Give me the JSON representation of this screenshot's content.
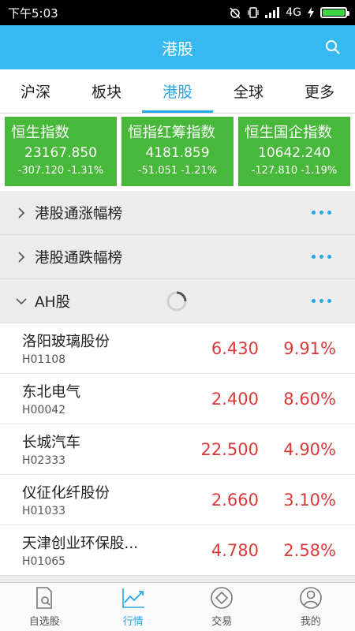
{
  "status": {
    "time": "下午5:03",
    "network": "4G"
  },
  "header": {
    "title": "港股"
  },
  "tabs": [
    {
      "label": "沪深"
    },
    {
      "label": "板块"
    },
    {
      "label": "港股",
      "active": true
    },
    {
      "label": "全球"
    },
    {
      "label": "更多"
    }
  ],
  "indices": [
    {
      "name": "恒生指数",
      "value": "23167.850",
      "change": "-307.120  -1.31%"
    },
    {
      "name": "恒指红筹指数",
      "value": "4181.859",
      "change": "-51.051  -1.21%"
    },
    {
      "name": "恒生国企指数",
      "value": "10642.240",
      "change": "-127.810  -1.19%"
    }
  ],
  "sections": [
    {
      "label": "港股通涨幅榜",
      "expanded": false
    },
    {
      "label": "港股通跌幅榜",
      "expanded": false
    },
    {
      "label": "AH股",
      "expanded": true
    }
  ],
  "stocks": [
    {
      "name": "洛阳玻璃股份",
      "code": "H01108",
      "price": "6.430",
      "pct": "9.91%"
    },
    {
      "name": "东北电气",
      "code": "H00042",
      "price": "2.400",
      "pct": "8.60%"
    },
    {
      "name": "长城汽车",
      "code": "H02333",
      "price": "22.500",
      "pct": "4.90%"
    },
    {
      "name": "仪征化纤股份",
      "code": "H01033",
      "price": "2.660",
      "pct": "3.10%"
    },
    {
      "name": "天津创业环保股...",
      "code": "H01065",
      "price": "4.780",
      "pct": "2.58%"
    }
  ],
  "nav": [
    {
      "label": "自选股"
    },
    {
      "label": "行情",
      "active": true
    },
    {
      "label": "交易"
    },
    {
      "label": "我的"
    }
  ],
  "colors": {
    "header": "#36b8f0",
    "accent": "#27a6e6",
    "index_card": "#47b83a",
    "up": "#dc3a3a"
  }
}
